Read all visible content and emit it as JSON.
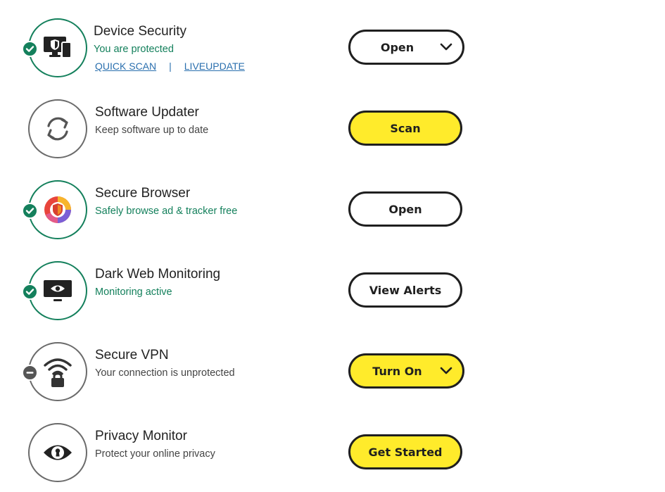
{
  "rows": [
    {
      "title": "Device Security",
      "subtitle": "You are protected",
      "links": [
        "QUICK SCAN",
        "LIVEUPDATE"
      ],
      "separator": "|",
      "status": "protected",
      "icon": "device-shield-icon",
      "button": "Open"
    },
    {
      "title": "Software Updater",
      "subtitle": "Keep software up to date",
      "status": "none",
      "icon": "refresh-icon",
      "button": "Scan"
    },
    {
      "title": "Secure Browser",
      "subtitle": "Safely browse ad & tracker free",
      "status": "protected",
      "icon": "browser-logo-icon",
      "button": "Open"
    },
    {
      "title": "Dark Web Monitoring",
      "subtitle": "Monitoring active",
      "status": "protected",
      "icon": "monitor-eye-icon",
      "button": "View Alerts"
    },
    {
      "title": "Secure VPN",
      "subtitle": "Your connection is unprotected",
      "status": "off",
      "icon": "wifi-lock-icon",
      "button": "Turn On"
    },
    {
      "title": "Privacy Monitor",
      "subtitle": "Protect your online privacy",
      "status": "none",
      "icon": "eye-keyhole-icon",
      "button": "Get Started"
    }
  ],
  "colors": {
    "protected": "#14805c",
    "neutral": "#6b6b6b",
    "accent_yellow": "#ffeb2b",
    "link": "#2a6fae"
  }
}
